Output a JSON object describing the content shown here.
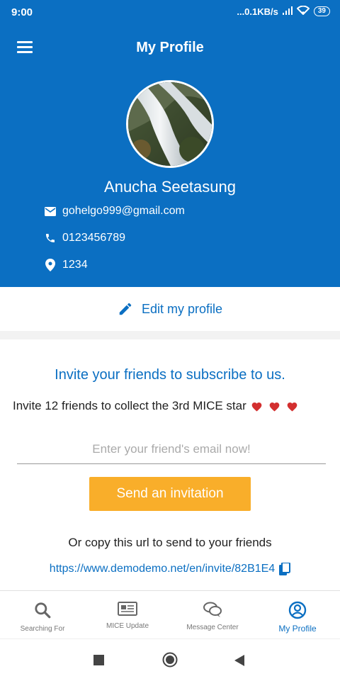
{
  "status": {
    "time": "9:00",
    "network": "...0.1KB/s",
    "battery": "39"
  },
  "header": {
    "title": "My Profile"
  },
  "profile": {
    "name": "Anucha Seetasung",
    "email": "gohelgo999@gmail.com",
    "phone": "0123456789",
    "location": "1234"
  },
  "edit": {
    "label": "Edit my profile"
  },
  "invite": {
    "title": "Invite your friends to subscribe to us.",
    "subtitle": "Invite 12 friends to collect the 3rd MICE star",
    "input_placeholder": "Enter your friend's email now!",
    "button_label": "Send an invitation",
    "copy_text": "Or copy this url to send to your friends",
    "url": "https://www.demodemo.net/en/invite/82B1E4"
  },
  "tabs": [
    {
      "label": "Searching For",
      "icon": "search-icon"
    },
    {
      "label": "MICE Update",
      "icon": "newspaper-icon"
    },
    {
      "label": "Message Center",
      "icon": "chat-icon"
    },
    {
      "label": "My Profile",
      "icon": "profile-icon",
      "active": true
    }
  ],
  "colors": {
    "primary": "#0b6fc2",
    "accent": "#f9ae2a",
    "heart": "#d32f2f"
  }
}
